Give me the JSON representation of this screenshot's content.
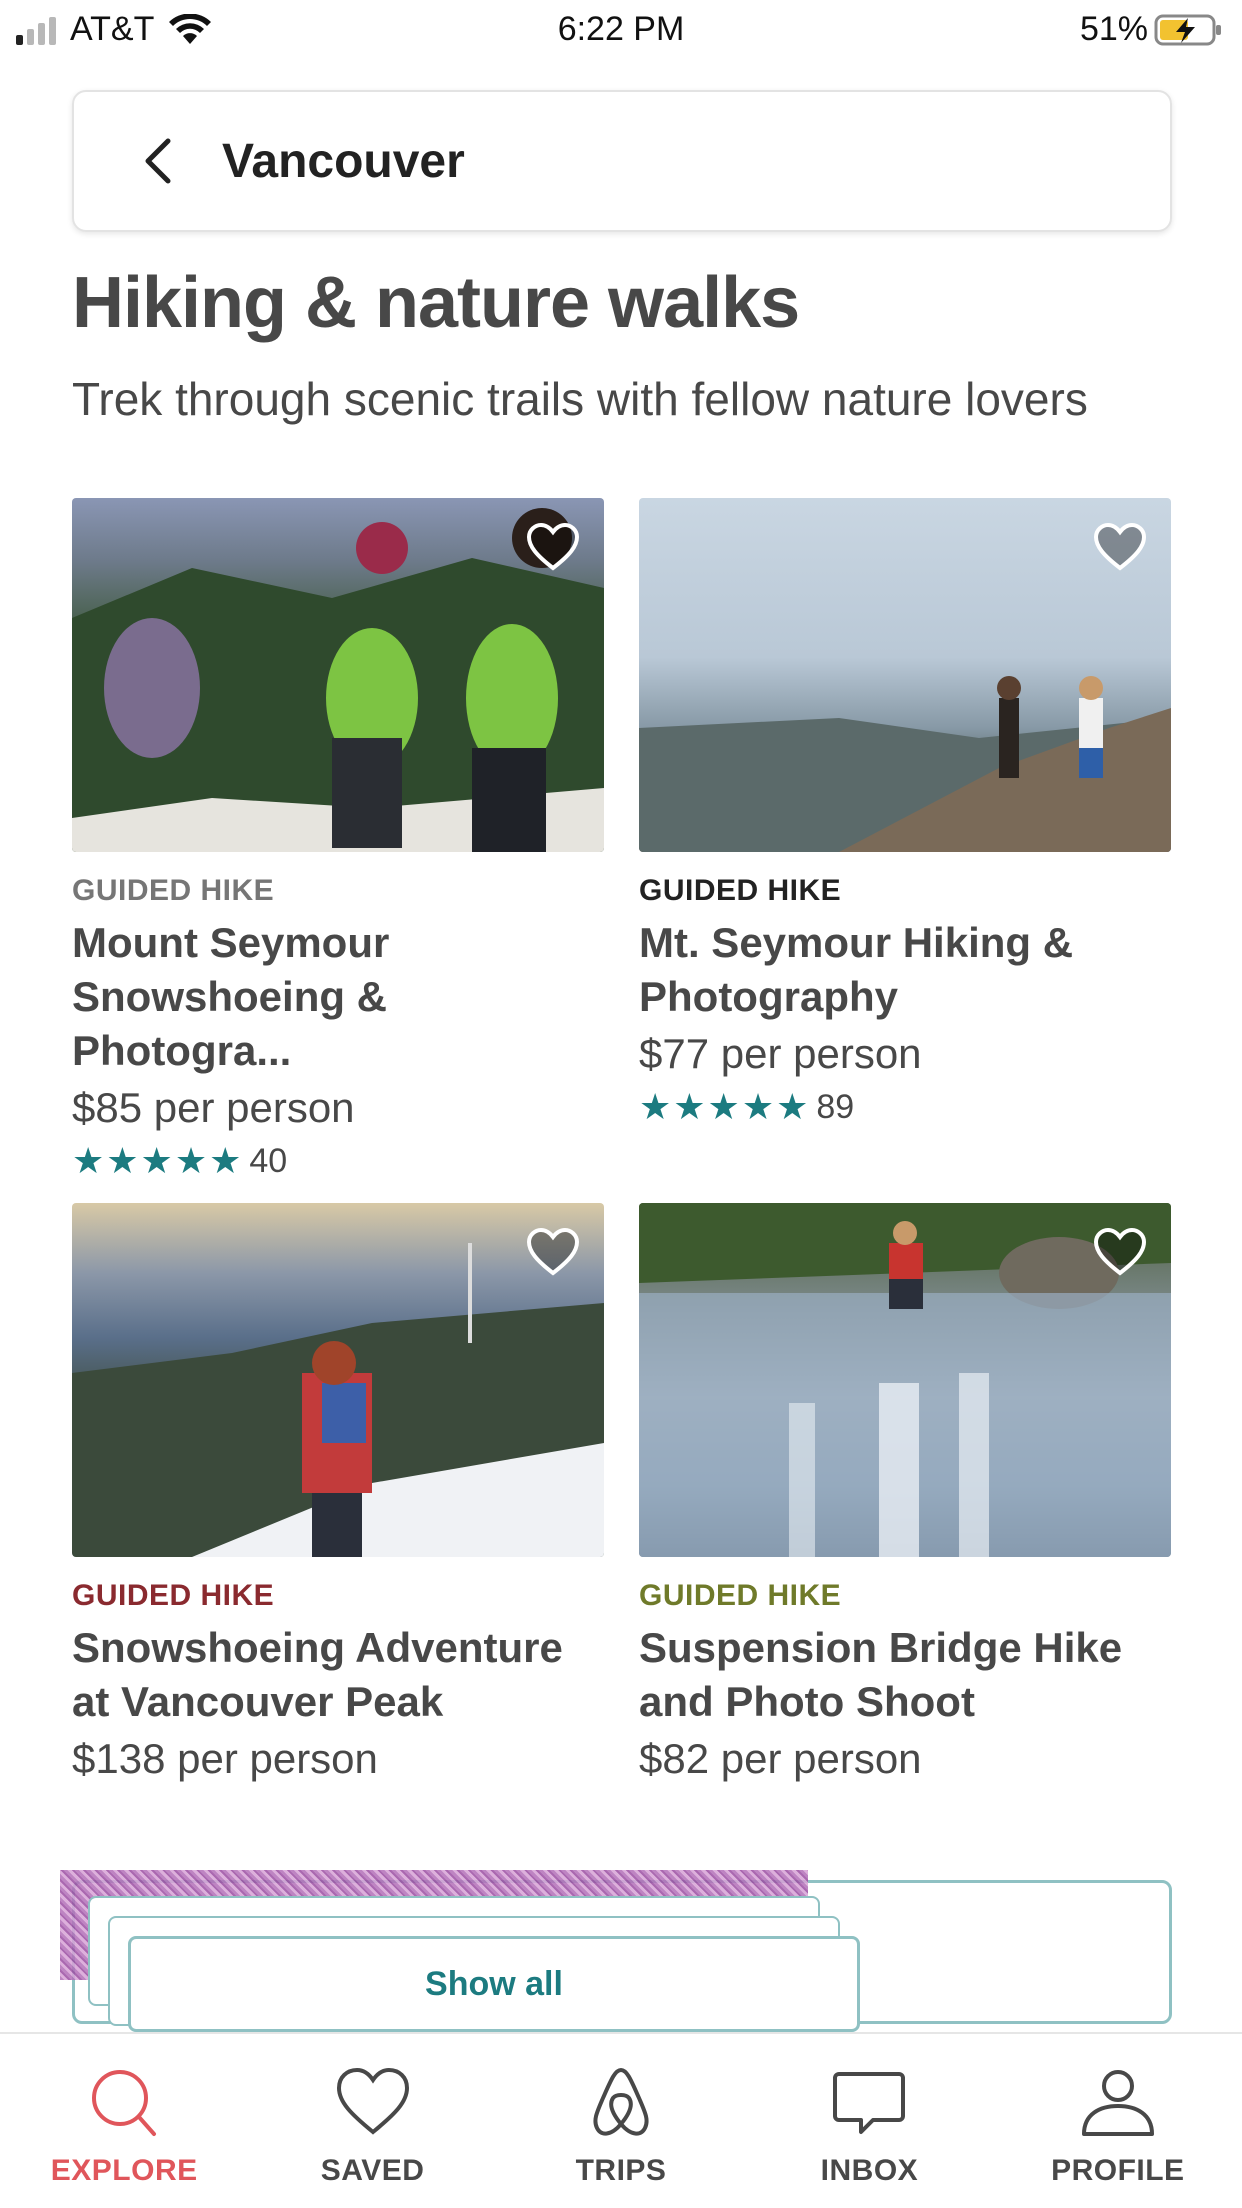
{
  "status_bar": {
    "carrier": "AT&T",
    "time": "6:22 PM",
    "battery": "51%"
  },
  "header": {
    "title": "Vancouver",
    "back_icon": "chevron-left-icon"
  },
  "section": {
    "title": "Hiking & nature walks",
    "subtitle": "Trek through scenic trails with fellow nature lovers"
  },
  "cards": [
    {
      "category": "GUIDED HIKE",
      "category_color": "#767676",
      "title": "Mount Seymour Snowshoeing & Photogra...",
      "price": "$85 per person",
      "stars": "★★★★★",
      "reviews": "40"
    },
    {
      "category": "GUIDED HIKE",
      "category_color": "#222222",
      "title": "Mt. Seymour Hiking & Photography",
      "price": "$77 per person",
      "stars": "★★★★★",
      "reviews": "89"
    },
    {
      "category": "GUIDED HIKE",
      "category_color": "#8a2a2f",
      "title": "Snowshoeing Adventure at Vancouver Peak",
      "price": "$138 per person"
    },
    {
      "category": "GUIDED HIKE",
      "category_color": "#6f7a2a",
      "title": "Suspension Bridge Hike and Photo Shoot",
      "price": "$82 per person"
    }
  ],
  "show_all": "Show all",
  "nav": [
    {
      "label": "EXPLORE",
      "icon": "search-icon",
      "active": true
    },
    {
      "label": "SAVED",
      "icon": "heart-icon"
    },
    {
      "label": "TRIPS",
      "icon": "airbnb-logo-icon"
    },
    {
      "label": "INBOX",
      "icon": "chat-bubble-icon"
    },
    {
      "label": "PROFILE",
      "icon": "user-icon"
    }
  ],
  "colors": {
    "accent": "#1c7b80",
    "active_nav": "#e0565b"
  }
}
